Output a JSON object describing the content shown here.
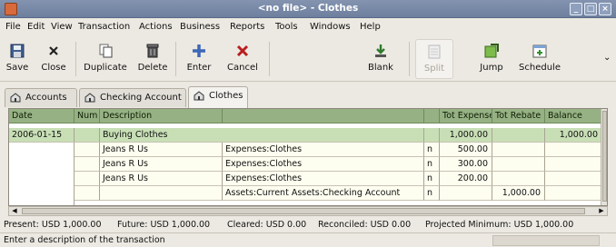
{
  "window": {
    "title": "<no file> - Clothes"
  },
  "menu": [
    "File",
    "Edit",
    "View",
    "Transaction",
    "Actions",
    "Business",
    "Reports",
    "Tools",
    "Windows",
    "Help"
  ],
  "toolbar": {
    "save": "Save",
    "close": "Close",
    "duplicate": "Duplicate",
    "delete": "Delete",
    "enter": "Enter",
    "cancel": "Cancel",
    "blank": "Blank",
    "split": "Split",
    "jump": "Jump",
    "schedule": "Schedule"
  },
  "tabs": [
    "Accounts",
    "Checking Account",
    "Clothes"
  ],
  "register": {
    "headers": {
      "date": "Date",
      "num": "Num",
      "description": "Description",
      "transfer": "",
      "r": "",
      "expense": "Tot Expense",
      "rebate": "Tot Rebate",
      "balance": "Balance"
    },
    "transaction": {
      "date": "2006-01-15",
      "num": "",
      "description": "Buying Clothes",
      "expense": "1,000.00",
      "rebate": "",
      "balance": "1,000.00"
    },
    "splits": [
      {
        "memo": "Jeans R Us",
        "account": "Expenses:Clothes",
        "r": "n",
        "expense": "500.00",
        "rebate": ""
      },
      {
        "memo": "Jeans R Us",
        "account": "Expenses:Clothes",
        "r": "n",
        "expense": "300.00",
        "rebate": ""
      },
      {
        "memo": "Jeans R Us",
        "account": "Expenses:Clothes",
        "r": "n",
        "expense": "200.00",
        "rebate": ""
      },
      {
        "memo": "",
        "account": "Assets:Current Assets:Checking Account",
        "r": "n",
        "expense": "",
        "rebate": "1,000.00"
      }
    ]
  },
  "summary": {
    "present": "Present: USD 1,000.00",
    "future": "Future: USD 1,000.00",
    "cleared": "Cleared: USD 0.00",
    "reconciled": "Reconciled: USD 0.00",
    "projected": "Projected Minimum: USD 1,000.00"
  },
  "status": {
    "message": "Enter a description of the transaction"
  }
}
